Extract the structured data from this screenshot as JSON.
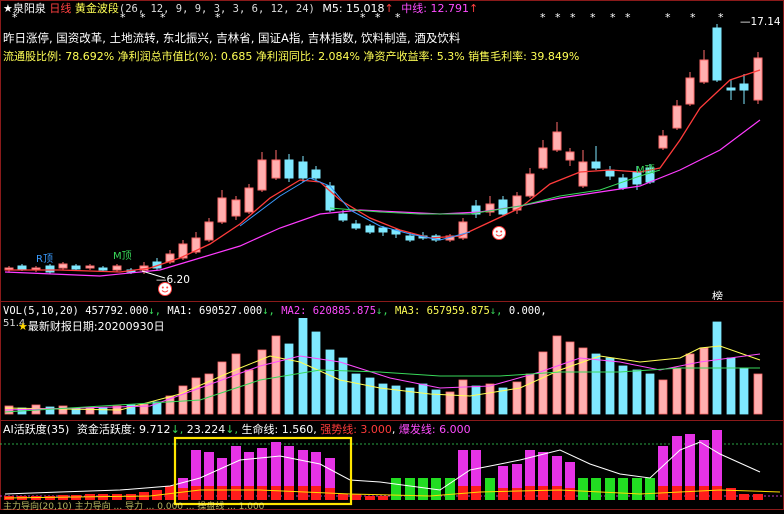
{
  "header": {
    "star": "★",
    "stock_name": "泉阳泉",
    "period": "日线",
    "indicator": "黄金波段",
    "params": "(26, 12, 9, 9, 3, 3, 6, 12, 24)",
    "m5_label": "M5: 15.018",
    "m5_arrow": "↑",
    "mid_label": "中线: 12.791",
    "mid_arrow": "↑"
  },
  "concepts": "昨日涨停, 国资改革, 土地流转, 东北振兴, 吉林省, 国证A指, 吉林指数, 饮料制造, 酒及饮料",
  "fundamentals": "流通股比例: 78.692%  净利润总市值比(%): 0.685  净利润同比: 2.084%  净资产收益率: 5.3%  销售毛利率: 39.849%",
  "price_panel": {
    "high_label": "17.14",
    "low_label": "6.20",
    "r_top": "R顶",
    "m_top_left": "M顶",
    "m_top_right": "M顶",
    "rank_label": "榜",
    "stars": [
      "*",
      "*",
      "*",
      "*",
      "*",
      "*",
      "*",
      "*",
      "*",
      "*",
      "*",
      "*",
      "*",
      "*",
      "*",
      "*",
      "*"
    ],
    "colors": {
      "up": "#ff6b6b",
      "up_fill": "#ffb0b0",
      "down": "#7fe9ff",
      "m5": "#ff3b3b",
      "mid": "#ff3bff",
      "ma_blue": "#3a9bff",
      "ma_green": "#39d95a"
    }
  },
  "vol_panel": {
    "label": "VOL(5,10,20)",
    "value": "457792.000",
    "ma1": "MA1: 690527.000",
    "ma2": "MA2: 620885.875",
    "ma3": "MA3: 657959.875",
    "tail": "0.000,",
    "axis_value": "51.4",
    "report_date": "最新财报日期:20200930日"
  },
  "ai_panel": {
    "label": "AI活跃度(35)",
    "fund_label": "资金活跃度: 9.712",
    "v2": "23.224",
    "life_label": "生命线: 1.560",
    "strong_label": "强势线: 3.000",
    "burst_label": "爆发线: 6.000"
  },
  "bottom_row": "主力导向(20,10)  主力导向  ...  导力  ...  0.000  ...  操盘线 ...  1.000"
}
